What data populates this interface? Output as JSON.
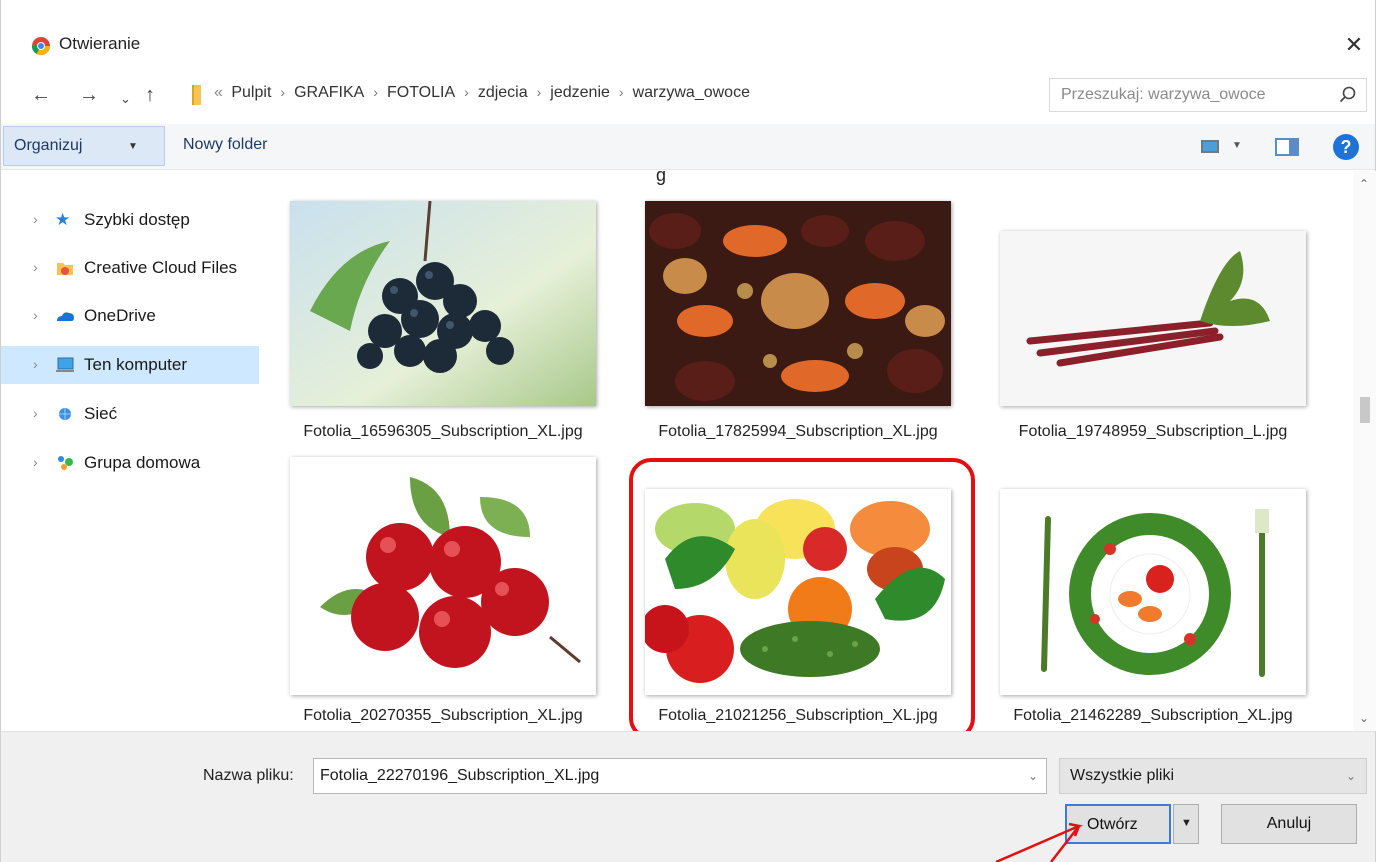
{
  "window": {
    "title": "Otwieranie",
    "close_glyph": "✕"
  },
  "nav": {
    "back": "←",
    "forward": "→",
    "recent": "⌄",
    "up": "↑",
    "refresh": "↻"
  },
  "address": {
    "overflow": "«",
    "breadcrumbs": [
      "Pulpit",
      "GRAFIKA",
      "FOTOLIA",
      "zdjecia",
      "jedzenie",
      "warzywa_owoce"
    ],
    "separator": "›"
  },
  "search": {
    "placeholder": "Przeszukaj: warzywa_owoce"
  },
  "toolbar": {
    "organize_label": "Organizuj",
    "newfolder_label": "Nowy folder",
    "help_label": "?"
  },
  "sidebar": {
    "items": [
      {
        "label": "Szybki dostęp",
        "icon": "star-icon"
      },
      {
        "label": "Creative Cloud Files",
        "icon": "creative-cloud-icon"
      },
      {
        "label": "OneDrive",
        "icon": "onedrive-icon"
      },
      {
        "label": "Ten komputer",
        "icon": "computer-icon",
        "selected": true
      },
      {
        "label": "Sieć",
        "icon": "network-icon"
      },
      {
        "label": "Grupa domowa",
        "icon": "homegroup-icon"
      }
    ]
  },
  "content": {
    "partial_name": "g",
    "files": [
      {
        "name": "Fotolia_16596305_Subscription_XL.jpg",
        "thumbnail": "berries on branch"
      },
      {
        "name": "Fotolia_17825994_Subscription_XL.jpg",
        "thumbnail": "dried fruits"
      },
      {
        "name": "Fotolia_19748959_Subscription_L.jpg",
        "thumbnail": "rhubarb stalks"
      },
      {
        "name": "Fotolia_20270355_Subscription_XL.jpg",
        "thumbnail": "red rosehips"
      },
      {
        "name": "Fotolia_21021256_Subscription_XL.jpg",
        "thumbnail": "mixed vegetables and fruits",
        "highlighted": true
      },
      {
        "name": "Fotolia_21462289_Subscription_XL.jpg",
        "thumbnail": "vegetable plate with fork"
      }
    ]
  },
  "footer": {
    "filename_label": "Nazwa pliku:",
    "filename_value": "Fotolia_22270196_Subscription_XL.jpg",
    "filter_value": "Wszystkie pliki",
    "open_label": "Otwórz",
    "cancel_label": "Anuluj"
  },
  "colors": {
    "highlight": "#e30f13",
    "selection": "#cde8ff",
    "accent": "#3a7bd5"
  }
}
